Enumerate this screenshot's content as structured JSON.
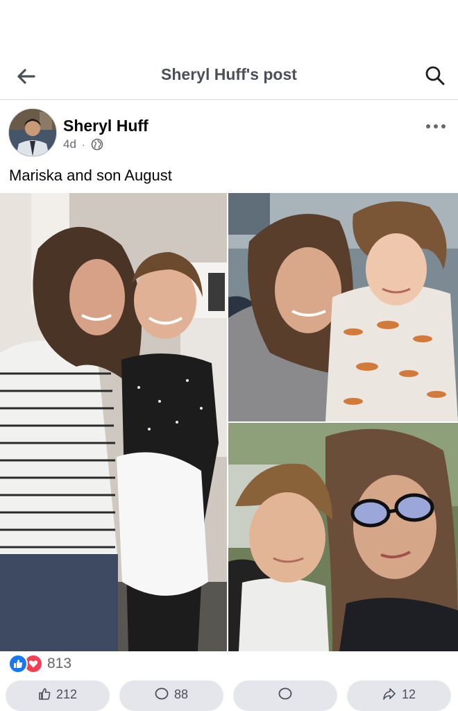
{
  "header": {
    "title": "Sheryl Huff's post"
  },
  "post": {
    "author": "Sheryl Huff",
    "time": "4d",
    "separator": "·",
    "caption": "Mariska and son August"
  },
  "reactions": {
    "count": "813"
  },
  "actions": {
    "like_count": "212",
    "comment_count": "88",
    "share_count": "12"
  },
  "colors": {
    "like_blue": "#1877f2",
    "love_red": "#f33e58",
    "header_text": "#4b4f56"
  },
  "icons": {
    "back": "arrow-left-icon",
    "search": "search-icon",
    "privacy": "globe-icon",
    "more": "more-horizontal-icon"
  }
}
